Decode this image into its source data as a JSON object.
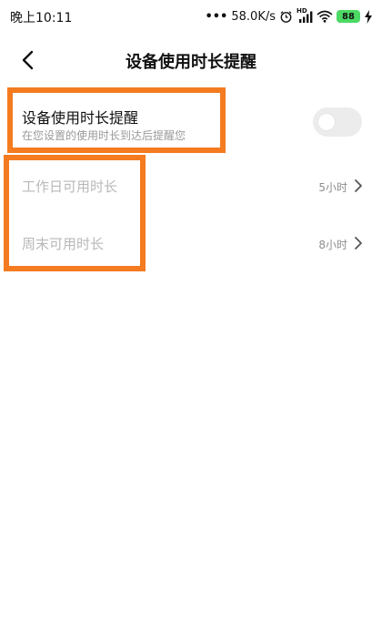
{
  "status_bar": {
    "time": "晚上10:11",
    "network_speed": "58.0K/s",
    "signal_label": "HD",
    "battery_level": "88",
    "battery_color": "#4cd964"
  },
  "header": {
    "title": "设备使用时长提醒",
    "back_icon": "chevron-left-icon"
  },
  "reminder_setting": {
    "title": "设备使用时长提醒",
    "subtitle": "在您设置的使用时长到达后提醒您",
    "enabled": false
  },
  "time_limits": [
    {
      "label": "工作日可用时长",
      "value": "5小时"
    },
    {
      "label": "周末可用时长",
      "value": "8小时"
    }
  ],
  "colors": {
    "highlight": "#f47b20",
    "toggle_track": "#ececec",
    "disabled_text": "#b8b8b8"
  }
}
